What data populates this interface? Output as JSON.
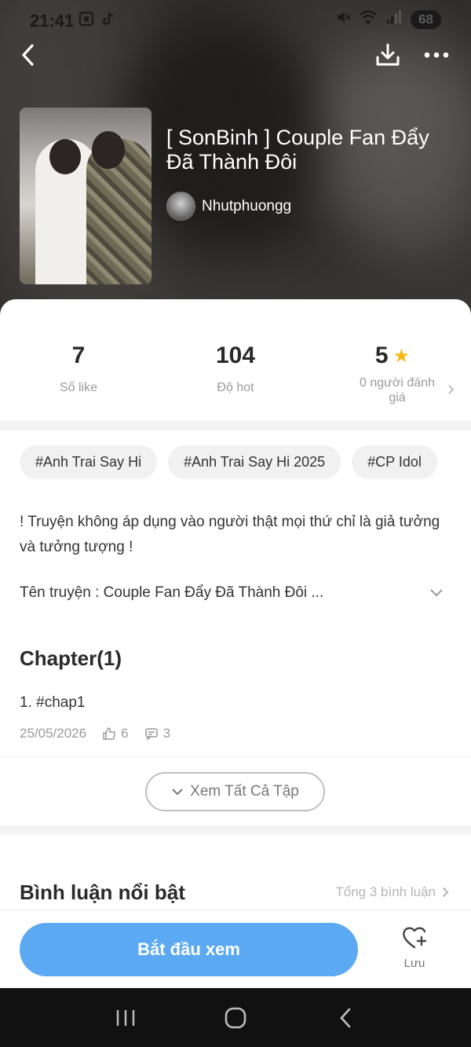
{
  "status": {
    "time": "21:41",
    "battery": "68",
    "left_icons": [
      "screenshot-icon",
      "tiktok-icon"
    ],
    "right_icons": [
      "mute-icon",
      "wifi-icon",
      "signal-icon"
    ]
  },
  "header": {
    "back_icon": "chevron-left-icon",
    "download_icon": "download-icon",
    "more_icon": "more-dots-icon"
  },
  "story": {
    "title": "[ SonBinh ] Couple Fan Đẩy Đã Thành Đôi",
    "author": "Nhutphuongg"
  },
  "stats": {
    "likes_value": "7",
    "likes_label": "Số like",
    "hot_value": "104",
    "hot_label": "Độ hot",
    "rating_value": "5",
    "rating_label": "0 người đánh giá"
  },
  "tags": [
    "#Anh Trai Say Hi",
    "#Anh Trai Say Hi 2025",
    "#CP Idol"
  ],
  "description": {
    "line1": "! Truyện không áp dụng vào người thật mọi thứ chỉ là giả tưởng và tưởng tượng !",
    "line2": "Tên truyện : Couple Fan Đẩy Đã Thành Đôi ..."
  },
  "chapters": {
    "heading": "Chapter(1)",
    "items": [
      {
        "title": "1. #chap1",
        "date": "25/05/2026",
        "likes": "6",
        "comments": "3"
      }
    ],
    "see_all": "Xem Tất Cả Tập"
  },
  "comments": {
    "heading": "Bình luận nổi bật",
    "total": "Tổng 3 bình luận"
  },
  "actions": {
    "start": "Bắt đầu xem",
    "save": "Lưu"
  },
  "colors": {
    "primary": "#5aa9f2",
    "star": "#f5b915"
  }
}
